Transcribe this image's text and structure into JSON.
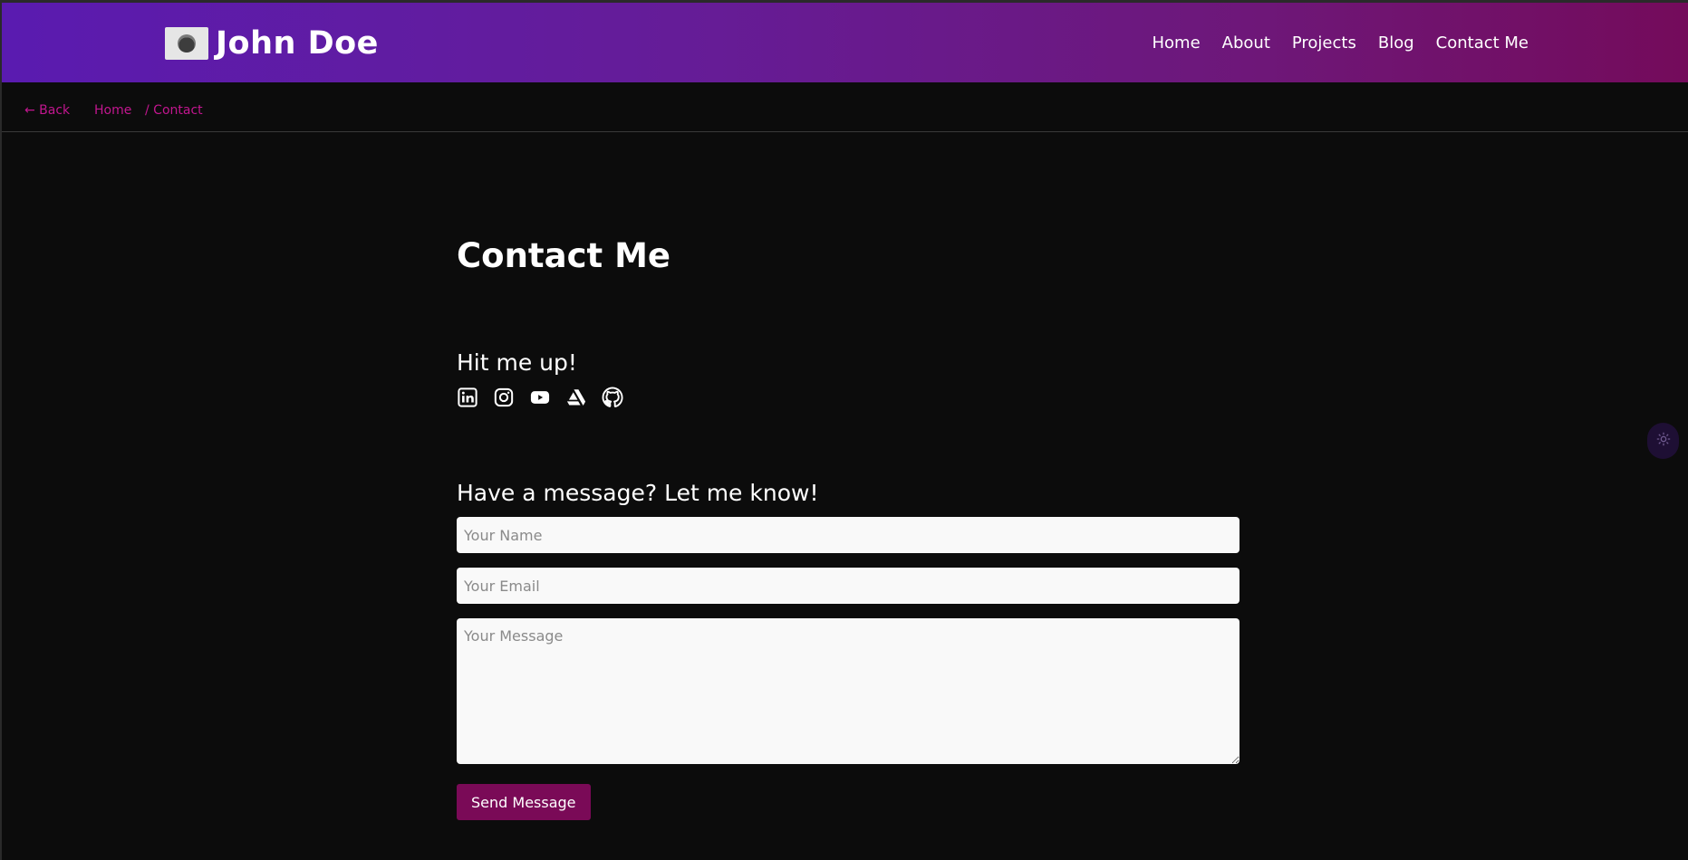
{
  "brand": {
    "name": "John Doe",
    "logo_icon": "mountain-avatar"
  },
  "nav": {
    "items": [
      {
        "label": "Home"
      },
      {
        "label": "About"
      },
      {
        "label": "Projects"
      },
      {
        "label": "Blog"
      },
      {
        "label": "Contact Me"
      }
    ]
  },
  "breadcrumb": {
    "back_label": "← Back",
    "home_label": "Home",
    "current_label": "/ Contact"
  },
  "main": {
    "title": "Contact Me",
    "social_heading": "Hit me up!",
    "socials": [
      {
        "icon": "linkedin-icon"
      },
      {
        "icon": "instagram-icon"
      },
      {
        "icon": "youtube-icon"
      },
      {
        "icon": "artstation-icon"
      },
      {
        "icon": "github-icon"
      }
    ],
    "form_heading": "Have a message? Let me know!",
    "form": {
      "name_placeholder": "Your Name",
      "email_placeholder": "Your Email",
      "message_placeholder": "Your Message",
      "send_label": "Send Message"
    }
  },
  "theme_toggle": {
    "icon": "sun-icon"
  },
  "colors": {
    "accent": "#c2168f",
    "button": "#7a0a57",
    "background": "#0c0c0c",
    "header_start": "#5a1bb0",
    "header_end": "#740b5b"
  }
}
